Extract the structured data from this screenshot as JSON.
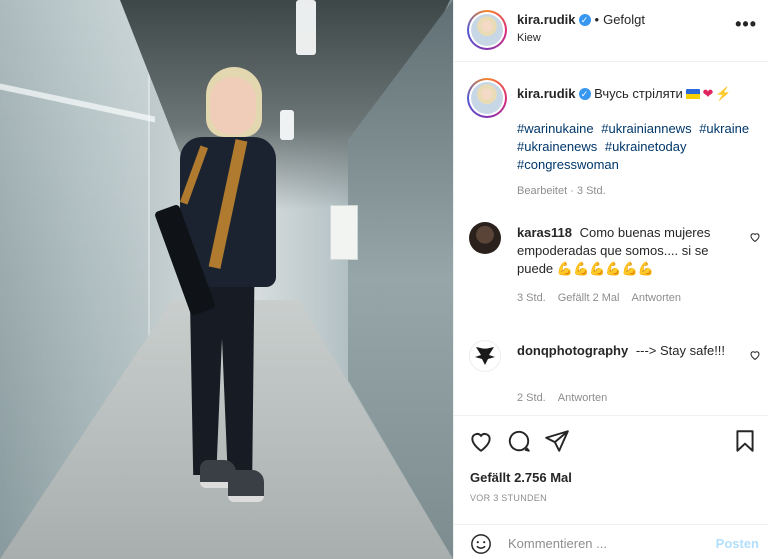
{
  "post": {
    "username": "kira.rudik",
    "follow_status": "Gefolgt",
    "location": "Kiew",
    "more_icon": "more-options-icon"
  },
  "caption": {
    "username": "kira.rudik",
    "text": "Вчусь стріляти",
    "emojis": [
      "ukraine-flag",
      "red-heart",
      "lightning"
    ],
    "hashtags": [
      "#warinukaine",
      "#ukrainiannews",
      "#ukraine",
      "#ukrainenews",
      "#ukrainetoday",
      "#congresswoman"
    ],
    "edited": "Bearbeitet · 3 Std."
  },
  "comments": [
    {
      "username": "karas118",
      "text": "Como buenas mujeres empoderadas que somos.... si se puede",
      "emoji": "💪💪💪💪💪💪",
      "time": "3 Std.",
      "likes": "Gefällt 2 Mal",
      "reply": "Antworten"
    },
    {
      "username": "donqphotography",
      "text": "---> Stay safe!!!",
      "time": "2 Std.",
      "reply": "Antworten"
    }
  ],
  "footer": {
    "likes": "Gefällt 2.756 Mal",
    "timestamp": "VOR 3 STUNDEN",
    "comment_placeholder": "Kommentieren ...",
    "post_label": "Posten"
  },
  "colors": {
    "verified": "#3897f0",
    "hashtag": "#00376b",
    "post_disabled": "#b2dffc",
    "muted": "#8e8e8e"
  }
}
